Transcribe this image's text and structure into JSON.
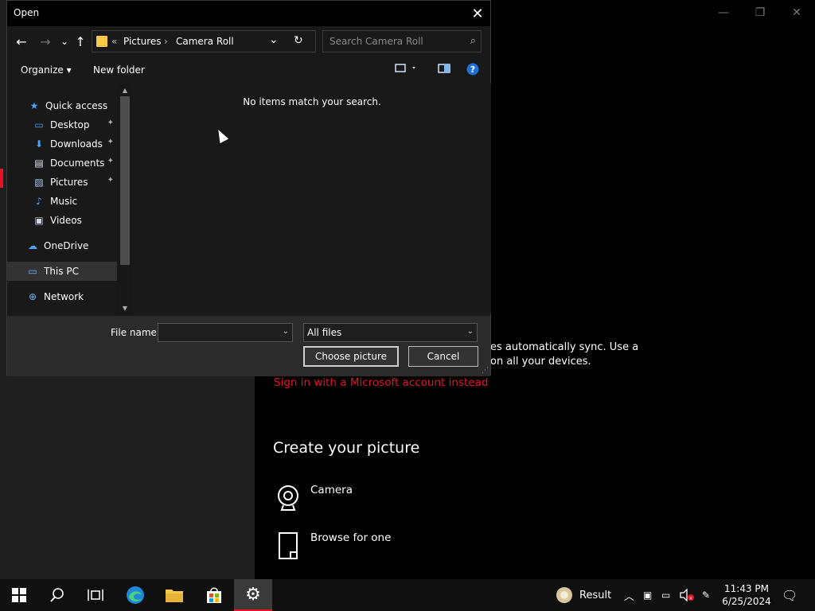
{
  "background_window": {
    "controls": [
      "—",
      "❐",
      "✕"
    ],
    "sync_text": "es automatically sync. Use a on all your devices.",
    "ms_link": "Sign in with a Microsoft account instead",
    "create_title": "Create your picture",
    "options": [
      {
        "label": "Camera",
        "icon": "webcam-icon"
      },
      {
        "label": "Browse for one",
        "icon": "file-icon"
      }
    ],
    "accent_color": "#e81123"
  },
  "dialog": {
    "title": "Open",
    "close_glyph": "✕",
    "nav": {
      "back": "←",
      "forward": "→",
      "recent": "⌄",
      "up": "↑"
    },
    "address": {
      "prefix": "«",
      "crumbs": [
        "Pictures",
        "Camera Roll"
      ],
      "separator": "›",
      "dropdown": "⌄",
      "refresh": "↻"
    },
    "search": {
      "placeholder": "Search Camera Roll",
      "icon": "⌕"
    },
    "toolbar": {
      "organize": "Organize ▾",
      "new_folder": "New folder"
    },
    "nav_items": [
      {
        "label": "Quick access",
        "icon": "★",
        "pinned": false
      },
      {
        "label": "Desktop",
        "icon": "▭",
        "pinned": true
      },
      {
        "label": "Downloads",
        "icon": "⬇",
        "pinned": true
      },
      {
        "label": "Documents",
        "icon": "▤",
        "pinned": true
      },
      {
        "label": "Pictures",
        "icon": "▨",
        "pinned": true
      },
      {
        "label": "Music",
        "icon": "♪",
        "pinned": false
      },
      {
        "label": "Videos",
        "icon": "▣",
        "pinned": false
      },
      {
        "label": "OneDrive",
        "icon": "☁",
        "pinned": false
      },
      {
        "label": "This PC",
        "icon": "▭",
        "pinned": false
      },
      {
        "label": "Network",
        "icon": "⊕",
        "pinned": false
      }
    ],
    "pin_glyph": "📌",
    "empty_message": "No items match your search.",
    "filename_label": "File name:",
    "filename_value": "",
    "filetype_value": "All files",
    "dropdown_glyph": "⌄",
    "choose_button": "Choose picture",
    "cancel_button": "Cancel"
  },
  "taskbar": {
    "tray_result": "Result",
    "time": "11:43 PM",
    "date": "6/25/2024"
  }
}
